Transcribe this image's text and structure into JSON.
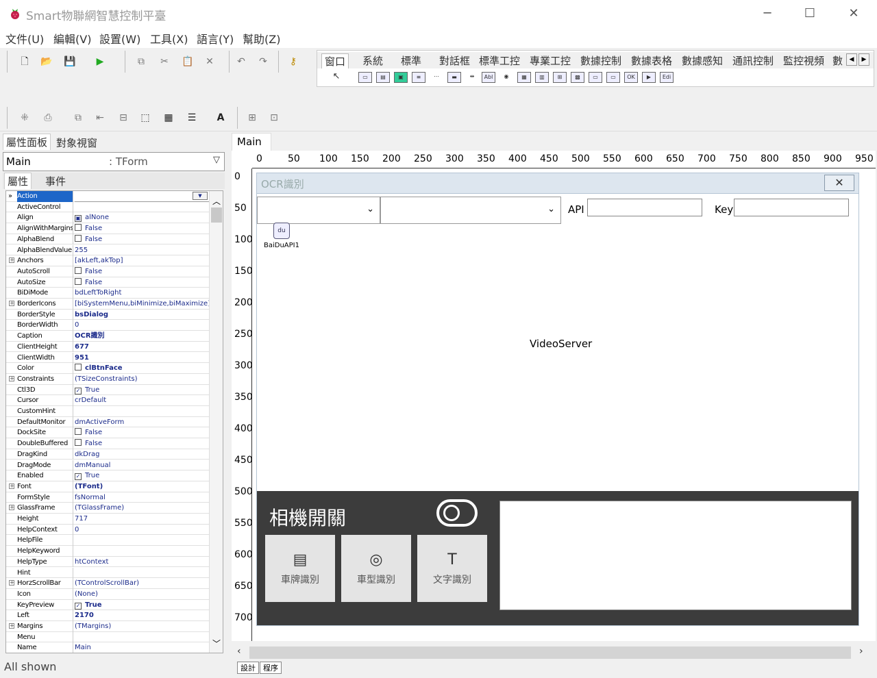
{
  "window": {
    "title": "Smart物聯網智慧控制平臺",
    "min": "─",
    "max": "☐",
    "close": "✕"
  },
  "menu": [
    "文件(U)",
    "編輯(V)",
    "設置(W)",
    "工具(X)",
    "語言(Y)",
    "幫助(Z)"
  ],
  "palette": {
    "tabs": [
      "窗口",
      "系統",
      "標準",
      "對話框",
      "標準工控",
      "專業工控",
      "數據控制",
      "數據表格",
      "數據感知",
      "通訊控制",
      "監控視頻",
      "數"
    ],
    "edit_comp": "Edi"
  },
  "left_tabs": [
    "屬性面板",
    "對象視窗"
  ],
  "object": {
    "name": "Main",
    "type": ": TForm"
  },
  "prop_tabs": [
    "屬性",
    "事件"
  ],
  "properties": [
    {
      "n": "Action",
      "v": "",
      "sel": true
    },
    {
      "n": "ActiveControl",
      "v": ""
    },
    {
      "n": "Align",
      "v": "alNone",
      "icon": "▣"
    },
    {
      "n": "AlignWithMargins",
      "v": "False",
      "chk": ""
    },
    {
      "n": "AlphaBlend",
      "v": "False",
      "chk": ""
    },
    {
      "n": "AlphaBlendValue",
      "v": "255"
    },
    {
      "n": "Anchors",
      "v": "[akLeft,akTop]",
      "exp": true
    },
    {
      "n": "AutoScroll",
      "v": "False",
      "chk": ""
    },
    {
      "n": "AutoSize",
      "v": "False",
      "chk": ""
    },
    {
      "n": "BiDiMode",
      "v": "bdLeftToRight"
    },
    {
      "n": "BorderIcons",
      "v": "[biSystemMenu,biMinimize,biMaximize]",
      "exp": true
    },
    {
      "n": "BorderStyle",
      "v": "bsDialog",
      "b": true
    },
    {
      "n": "BorderWidth",
      "v": "0"
    },
    {
      "n": "Caption",
      "v": "OCR識別",
      "b": true
    },
    {
      "n": "ClientHeight",
      "v": "677",
      "b": true
    },
    {
      "n": "ClientWidth",
      "v": "951",
      "b": true
    },
    {
      "n": "Color",
      "v": "clBtnFace",
      "b": true,
      "sw": true
    },
    {
      "n": "Constraints",
      "v": "(TSizeConstraints)",
      "exp": true
    },
    {
      "n": "Ctl3D",
      "v": "True",
      "chk": "✓"
    },
    {
      "n": "Cursor",
      "v": "crDefault"
    },
    {
      "n": "CustomHint",
      "v": ""
    },
    {
      "n": "DefaultMonitor",
      "v": "dmActiveForm"
    },
    {
      "n": "DockSite",
      "v": "False",
      "chk": ""
    },
    {
      "n": "DoubleBuffered",
      "v": "False",
      "chk": ""
    },
    {
      "n": "DragKind",
      "v": "dkDrag"
    },
    {
      "n": "DragMode",
      "v": "dmManual"
    },
    {
      "n": "Enabled",
      "v": "True",
      "chk": "✓"
    },
    {
      "n": "Font",
      "v": "(TFont)",
      "b": true,
      "exp": true
    },
    {
      "n": "FormStyle",
      "v": "fsNormal"
    },
    {
      "n": "GlassFrame",
      "v": "(TGlassFrame)",
      "exp": true
    },
    {
      "n": "Height",
      "v": "717"
    },
    {
      "n": "HelpContext",
      "v": "0"
    },
    {
      "n": "HelpFile",
      "v": ""
    },
    {
      "n": "HelpKeyword",
      "v": ""
    },
    {
      "n": "HelpType",
      "v": "htContext"
    },
    {
      "n": "Hint",
      "v": ""
    },
    {
      "n": "HorzScrollBar",
      "v": "(TControlScrollBar)",
      "exp": true
    },
    {
      "n": "Icon",
      "v": "(None)"
    },
    {
      "n": "KeyPreview",
      "v": "True",
      "chk": "✓",
      "b": true
    },
    {
      "n": "Left",
      "v": "2170",
      "b": true
    },
    {
      "n": "Margins",
      "v": "(TMargins)",
      "exp": true
    },
    {
      "n": "Menu",
      "v": ""
    },
    {
      "n": "Name",
      "v": "Main"
    }
  ],
  "status": "All shown",
  "designer": {
    "tab": "Main",
    "ruler_top": [
      "0",
      "50",
      "100",
      "150",
      "200",
      "250",
      "300",
      "350",
      "400",
      "450",
      "500",
      "550",
      "600",
      "650",
      "700",
      "750",
      "800",
      "850",
      "900",
      "950"
    ],
    "ruler_left": [
      "0",
      "50",
      "100",
      "150",
      "200",
      "250",
      "300",
      "350",
      "400",
      "450",
      "500",
      "550",
      "600",
      "650",
      "700"
    ],
    "bottom_tabs": [
      "設計",
      "程序"
    ]
  },
  "form": {
    "caption": "OCR識別",
    "api_label": "API",
    "key_label": "Key",
    "component_label": "BaiDuAPI1",
    "component_icon": "du",
    "video_label": "VideoServer",
    "camera_label": "相機開關",
    "tiles": [
      {
        "label": "車牌識別",
        "icon": "▤"
      },
      {
        "label": "車型識別",
        "icon": "◎"
      },
      {
        "label": "文字識別",
        "icon": "T"
      }
    ]
  }
}
